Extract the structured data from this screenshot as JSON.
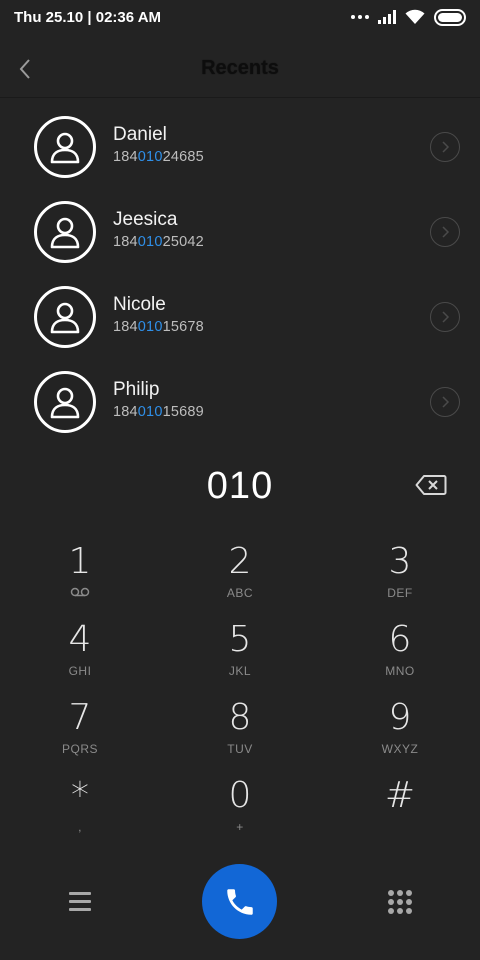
{
  "status_bar": {
    "time": "Thu 25.10 | 02:36 AM",
    "icons": [
      "more-dots-icon",
      "signal-icon",
      "wifi-icon",
      "battery-icon"
    ]
  },
  "header": {
    "title": "Recents",
    "back_icon": "chevron-left-icon"
  },
  "contacts": [
    {
      "name": "Daniel",
      "number_prefix": "184",
      "number_match": "010",
      "number_suffix": "24685"
    },
    {
      "name": "Jeesica",
      "number_prefix": "184",
      "number_match": "010",
      "number_suffix": "25042"
    },
    {
      "name": "Nicole",
      "number_prefix": "184",
      "number_match": "010",
      "number_suffix": "15678"
    },
    {
      "name": "Philip",
      "number_prefix": "184",
      "number_match": "010",
      "number_suffix": "15689"
    }
  ],
  "dialer": {
    "input": "010",
    "backspace_icon": "backspace-icon"
  },
  "keypad": [
    {
      "digit": "1",
      "letters": ""
    },
    {
      "digit": "2",
      "letters": "ABC"
    },
    {
      "digit": "3",
      "letters": "DEF"
    },
    {
      "digit": "4",
      "letters": "GHI"
    },
    {
      "digit": "5",
      "letters": "JKL"
    },
    {
      "digit": "6",
      "letters": "MNO"
    },
    {
      "digit": "7",
      "letters": "PQRS"
    },
    {
      "digit": "8",
      "letters": "TUV"
    },
    {
      "digit": "9",
      "letters": "WXYZ"
    },
    {
      "digit": "*",
      "letters": ","
    },
    {
      "digit": "0",
      "letters": "+"
    },
    {
      "digit": "#",
      "letters": ""
    }
  ],
  "colors": {
    "background": "#232323",
    "accent": "#2f8fe8",
    "call_button": "#1267d6"
  }
}
